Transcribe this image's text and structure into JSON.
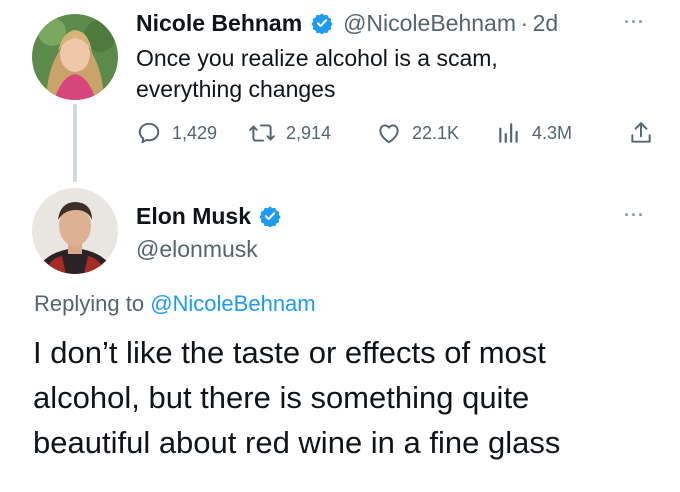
{
  "parent_tweet": {
    "author_name": "Nicole Behnam",
    "handle": "@NicoleBehnam",
    "separator": "·",
    "time": "2d",
    "text_line1": "Once you realize alcohol is a scam,",
    "text_line2": "everything changes",
    "more_label": "···",
    "stats": {
      "replies": "1,429",
      "retweets": "2,914",
      "likes": "22.1K",
      "views": "4.3M"
    }
  },
  "reply_tweet": {
    "author_name": "Elon Musk",
    "handle": "@elonmusk",
    "more_label": "···",
    "replying_prefix": "Replying to",
    "replying_to": "@NicoleBehnam",
    "text_line1": "I don’t like the taste or effects of most",
    "text_line2": "alcohol, but there is something quite",
    "text_line3": "beautiful about red wine in a fine glass"
  },
  "colors": {
    "verified_badge": "#1d9bf0",
    "secondary_text": "#536471",
    "link": "#1d9bf0",
    "thread_line": "#cfd9de"
  },
  "icons": [
    "reply-icon",
    "retweet-icon",
    "like-icon",
    "views-icon",
    "share-icon",
    "verified-badge-icon",
    "more-options-icon"
  ]
}
